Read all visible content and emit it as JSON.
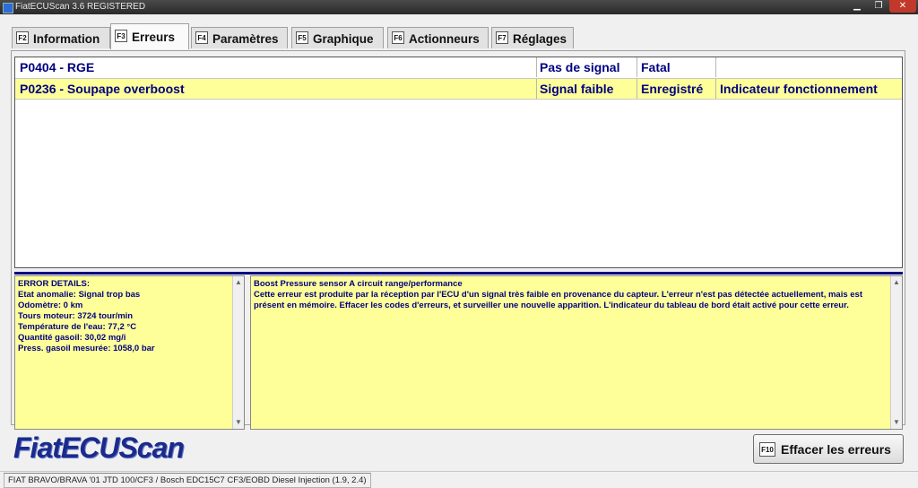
{
  "window": {
    "title": "FiatECUScan 3.6 REGISTERED",
    "minimize_icon": "minimize-icon",
    "maximize_icon": "restore-icon",
    "close_icon": "close-icon"
  },
  "tabs": [
    {
      "key": "F2",
      "label": "Information",
      "active": false
    },
    {
      "key": "F3",
      "label": "Erreurs",
      "active": true
    },
    {
      "key": "F4",
      "label": "Paramètres",
      "active": false
    },
    {
      "key": "F5",
      "label": "Graphique",
      "active": false
    },
    {
      "key": "F6",
      "label": "Actionneurs",
      "active": false
    },
    {
      "key": "F7",
      "label": "Réglages",
      "active": false
    }
  ],
  "errors": [
    {
      "code": "P0404 - RGE",
      "signal": "Pas de signal",
      "status": "Fatal",
      "indicator": ""
    },
    {
      "code": "P0236 - Soupape overboost",
      "signal": "Signal faible",
      "status": "Enregistré",
      "indicator": "Indicateur fonctionnement"
    }
  ],
  "details": {
    "header": "ERROR DETAILS:",
    "lines": [
      "Etat anomalie: Signal trop bas",
      "Odomètre: 0 km",
      "Tours moteur: 3724 tour/min",
      "Température de l'eau: 77,2 °C",
      "Quantité gasoil: 30,02 mg/i",
      "Press. gasoil mesurée: 1058,0 bar"
    ]
  },
  "description": {
    "title": "Boost Pressure sensor A circuit range/performance",
    "text": "Cette erreur est produite par la réception par l'ECU d'un signal très faible en provenance du capteur. L'erreur n'est pas détectée actuellement, mais est présent en mémoire. Effacer les codes d'erreurs, et surveiller une nouvelle apparition. L'indicateur du tableau de bord était activé pour cette erreur."
  },
  "logo": "FiatECUScan",
  "clear_button": {
    "key": "F10",
    "label": "Effacer les erreurs"
  },
  "status_bar": "FIAT BRAVO/BRAVA '01 JTD 100/CF3 / Bosch EDC15C7 CF3/EOBD Diesel Injection (1.9, 2.4)",
  "colors": {
    "highlight_row": "#ffff99",
    "text_blue": "#000080",
    "logo_blue": "#1a2b8a"
  }
}
